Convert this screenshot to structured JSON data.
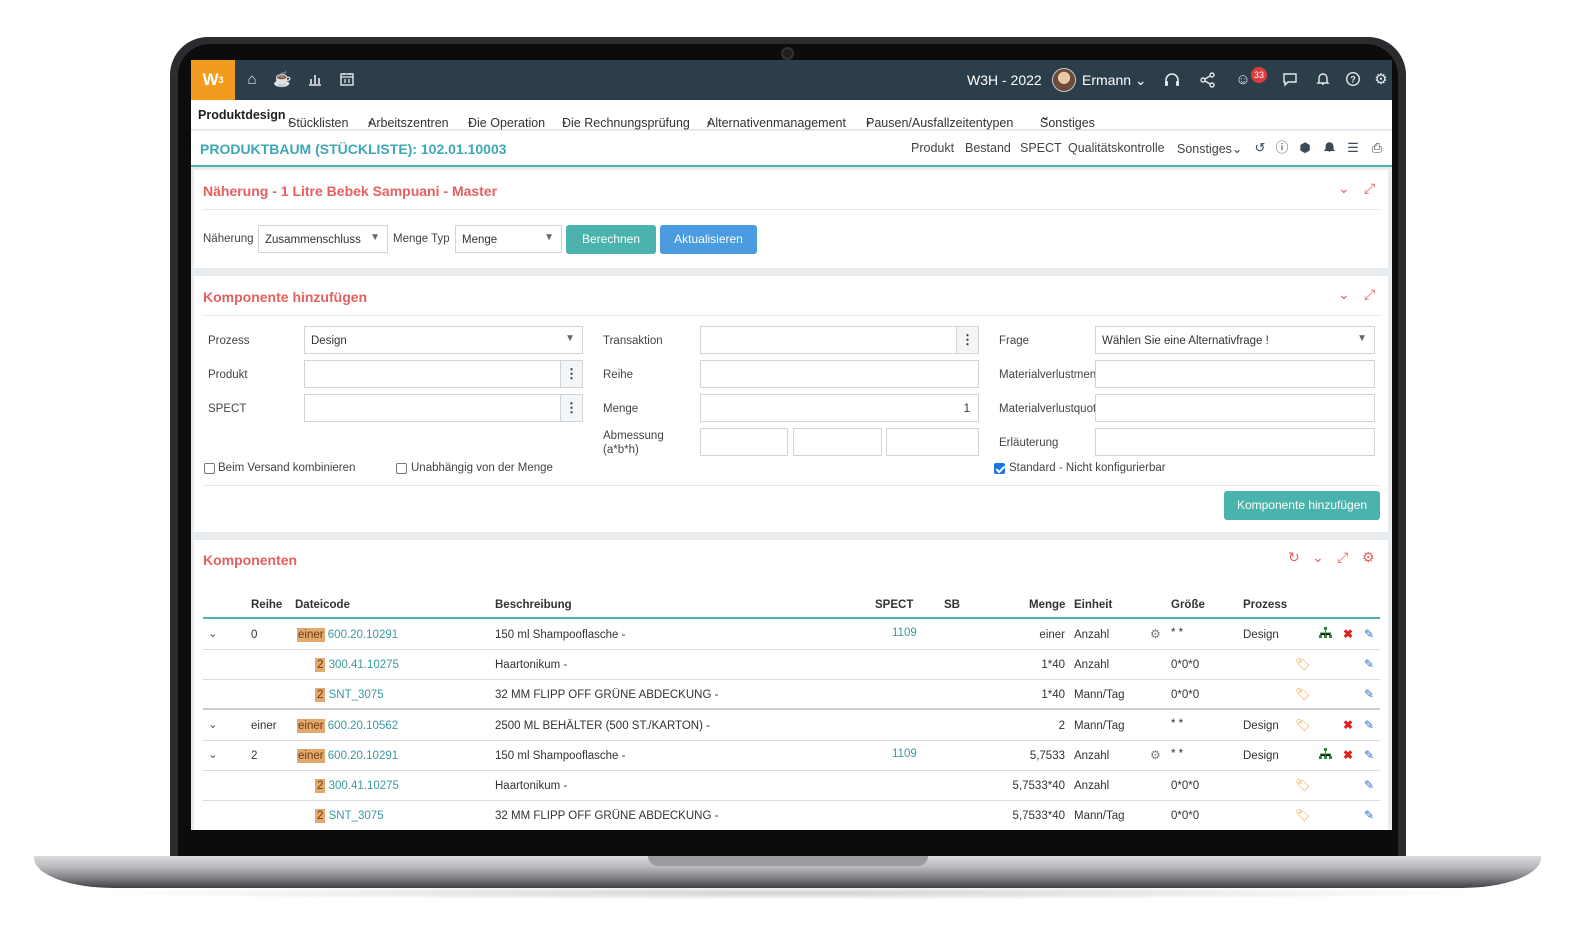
{
  "app": {
    "logo": "W",
    "logo_sup": "3",
    "title": "W3H - 2022",
    "user": "Ermann",
    "notifications_count": "33"
  },
  "menu": {
    "items": [
      "Produktdesign",
      "Stücklisten",
      "Arbeitszentren",
      "Die Operation",
      "Die Rechnungsprüfung",
      "Alternativenmanagement",
      "Pausen/Ausfallzeitentypen",
      "Sonstiges"
    ]
  },
  "page": {
    "title": "PRODUKTBAUM (STÜCKLISTE): 102.01.10003",
    "links": [
      "Produkt",
      "Bestand",
      "SPECT",
      "Qualitätskontrolle",
      "Sonstiges"
    ]
  },
  "approximation": {
    "title": "Näherung - 1 Litre Bebek Sampuani - Master",
    "naeherung_label": "Näherung",
    "naeherung_value": "Zusammenschluss",
    "menge_typ_label": "Menge Typ",
    "menge_typ_value": "Menge",
    "berechnen": "Berechnen",
    "aktualisieren": "Aktualisieren"
  },
  "add_component": {
    "title": "Komponente hinzufügen",
    "prozess_label": "Prozess",
    "prozess_value": "Design",
    "produkt_label": "Produkt",
    "spect_label": "SPECT",
    "transaktion_label": "Transaktion",
    "reihe_label": "Reihe",
    "menge_label": "Menge",
    "menge_value": "1",
    "abmessung_label_1": "Abmessung",
    "abmessung_label_2": "(a*b*h)",
    "frage_label": "Frage",
    "frage_value": "Wählen Sie eine Alternativfrage !",
    "materialverlust_menge_label": "Materialverlustmenge",
    "materialverlust_quote_label": "Materialverlustquote",
    "erlaeuterung_label": "Erläuterung",
    "beim_versand": "Beim Versand kombinieren",
    "unabhaengig": "Unabhängig von der Menge",
    "standard": "Standard - Nicht konfigurierbar",
    "submit": "Komponente hinzufügen"
  },
  "components": {
    "title": "Komponenten",
    "headers": {
      "reihe": "Reihe",
      "dateicode": "Dateicode",
      "beschreibung": "Beschreibung",
      "spect": "SPECT",
      "sb": "SB",
      "menge": "Menge",
      "einheit": "Einheit",
      "groesse": "Größe",
      "prozess": "Prozess"
    },
    "rows": [
      {
        "reihe": "0",
        "tag": "einer",
        "code": "600.20.10291",
        "desc": "150 ml Shampooflasche -",
        "spect": "1109",
        "menge": "einer",
        "einheit": "Anzahl",
        "groesse": "* *",
        "prozess": "Design"
      },
      {
        "reihe": "",
        "tag": "2",
        "code": "300.41.10275",
        "desc": "Haartonikum -",
        "spect": "",
        "menge": "1*40",
        "einheit": "Anzahl",
        "groesse": "0*0*0",
        "prozess": ""
      },
      {
        "reihe": "",
        "tag": "2",
        "code": "SNT_3075",
        "desc": "32 MM FLIPP OFF GRÜNE ABDECKUNG -",
        "spect": "",
        "menge": "1*40",
        "einheit": "Mann/Tag",
        "groesse": "0*0*0",
        "prozess": ""
      },
      {
        "reihe": "einer",
        "tag": "einer",
        "code": "600.20.10562",
        "desc": "2500 ML BEHÄLTER (500 ST./KARTON) -",
        "spect": "",
        "menge": "2",
        "einheit": "Mann/Tag",
        "groesse": "* *",
        "prozess": "Design"
      },
      {
        "reihe": "2",
        "tag": "einer",
        "code": "600.20.10291",
        "desc": "150 ml Shampooflasche -",
        "spect": "1109",
        "menge": "5,7533",
        "einheit": "Anzahl",
        "groesse": "* *",
        "prozess": "Design"
      },
      {
        "reihe": "",
        "tag": "2",
        "code": "300.41.10275",
        "desc": "Haartonikum -",
        "spect": "",
        "menge": "5,7533*40",
        "einheit": "Anzahl",
        "groesse": "0*0*0",
        "prozess": ""
      },
      {
        "reihe": "",
        "tag": "2",
        "code": "SNT_3075",
        "desc": "32 MM FLIPP OFF GRÜNE ABDECKUNG -",
        "spect": "",
        "menge": "5,7533*40",
        "einheit": "Mann/Tag",
        "groesse": "0*0*0",
        "prozess": ""
      }
    ]
  },
  "colors": {
    "topbar": "#2d3e4b",
    "logo": "#f39b1f",
    "accent_teal": "#3ea7b6",
    "panel_title": "#e4605f",
    "btn_teal": "#4ab3ad",
    "btn_blue": "#4a9be0"
  }
}
